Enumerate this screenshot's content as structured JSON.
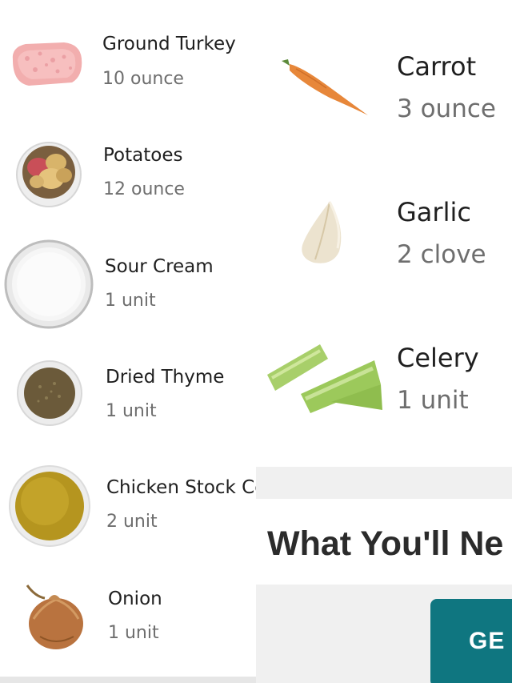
{
  "left_list": [
    {
      "name": "Ground Turkey",
      "qty": "10 ounce",
      "icon": "ground-turkey-icon"
    },
    {
      "name": "Potatoes",
      "qty": "12 ounce",
      "icon": "potatoes-icon"
    },
    {
      "name": "Sour Cream",
      "qty": "1 unit",
      "icon": "sour-cream-icon"
    },
    {
      "name": "Dried Thyme",
      "qty": "1 unit",
      "icon": "dried-thyme-icon"
    },
    {
      "name": "Chicken Stock Co",
      "qty": "2 unit",
      "icon": "chicken-stock-icon"
    },
    {
      "name": "Onion",
      "qty": "1 unit",
      "icon": "onion-icon"
    }
  ],
  "right_list": [
    {
      "name": "Carrot",
      "qty": "3 ounce",
      "icon": "carrot-icon"
    },
    {
      "name": "Garlic",
      "qty": "2 clove",
      "icon": "garlic-icon"
    },
    {
      "name": "Celery",
      "qty": "1 unit",
      "icon": "celery-icon"
    }
  ],
  "section": {
    "title": "What You'll Ne"
  },
  "cta": {
    "label": "GE"
  },
  "colors": {
    "cta": "#0f7680",
    "panel_grey": "#f0f0f0",
    "qty_text": "#6e6e6e"
  }
}
